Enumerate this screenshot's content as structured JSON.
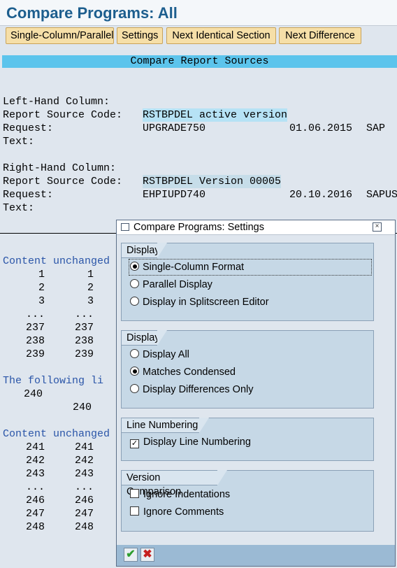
{
  "window": {
    "title": "Compare Programs: All"
  },
  "toolbar": {
    "buttons": [
      "Single-Column/Parallel",
      "Settings",
      "Next Identical Section",
      "Next Difference"
    ]
  },
  "report": {
    "banner": "Compare Report Sources",
    "left": {
      "heading": "Left-Hand Column:",
      "source_label": "Report Source Code:",
      "source_value": "RSTBPDEL active version",
      "request_label": "Request:",
      "request_value": "UPGRADE750",
      "request_date": "01.06.2015",
      "request_user": "SAP",
      "text_label": "Text:"
    },
    "right": {
      "heading": "Right-Hand Column:",
      "source_label": "Report Source Code:",
      "source_value": "RSTBPDEL Version 00005",
      "request_label": "Request:",
      "request_value": "EHPIUPD740",
      "request_date": "20.10.2016",
      "request_user": "SAPUS",
      "text_label": "Text:"
    },
    "section1": {
      "heading": "Content unchanged",
      "rows": [
        [
          "1",
          "1"
        ],
        [
          "2",
          "2"
        ],
        [
          "3",
          "3"
        ],
        [
          "...",
          "..."
        ],
        [
          "237",
          "237"
        ],
        [
          "238",
          "238"
        ],
        [
          "239",
          "239"
        ]
      ]
    },
    "section2": {
      "heading": "The following li",
      "left_line": "240",
      "right_line": "240"
    },
    "section3": {
      "heading": "Content unchanged",
      "rows": [
        [
          "241",
          "241"
        ],
        [
          "242",
          "242"
        ],
        [
          "243",
          "243"
        ],
        [
          "...",
          "..."
        ],
        [
          "246",
          "246"
        ],
        [
          "247",
          "247"
        ],
        [
          "248",
          "248"
        ]
      ]
    }
  },
  "dialog": {
    "title": "Compare Programs: Settings",
    "groups": {
      "display_format": {
        "label": "Display",
        "options": [
          "Single-Column Format",
          "Parallel Display",
          "Display in Splitscreen Editor"
        ],
        "selected": "Single-Column Format"
      },
      "display_mode": {
        "label": "Display",
        "options": [
          "Display All",
          "Matches Condensed",
          "Display Differences Only"
        ],
        "selected": "Matches Condensed"
      },
      "line_numbering": {
        "label": "Line Numbering",
        "option": "Display Line Numbering",
        "checked": true
      },
      "version_comparison": {
        "label": "Version Comparison",
        "options": [
          "Ignore Indentations",
          "Ignore Comments"
        ],
        "checked": [
          false,
          false
        ]
      }
    },
    "footer": {
      "ok_icon": "checkmark-icon",
      "cancel_icon": "cancel-x-icon"
    }
  },
  "colors": {
    "title": "#1d5e8e",
    "banner": "#5cc4ec",
    "button": "#f6dfa8",
    "ok": "#2e9e2e",
    "cancel": "#c62020"
  }
}
